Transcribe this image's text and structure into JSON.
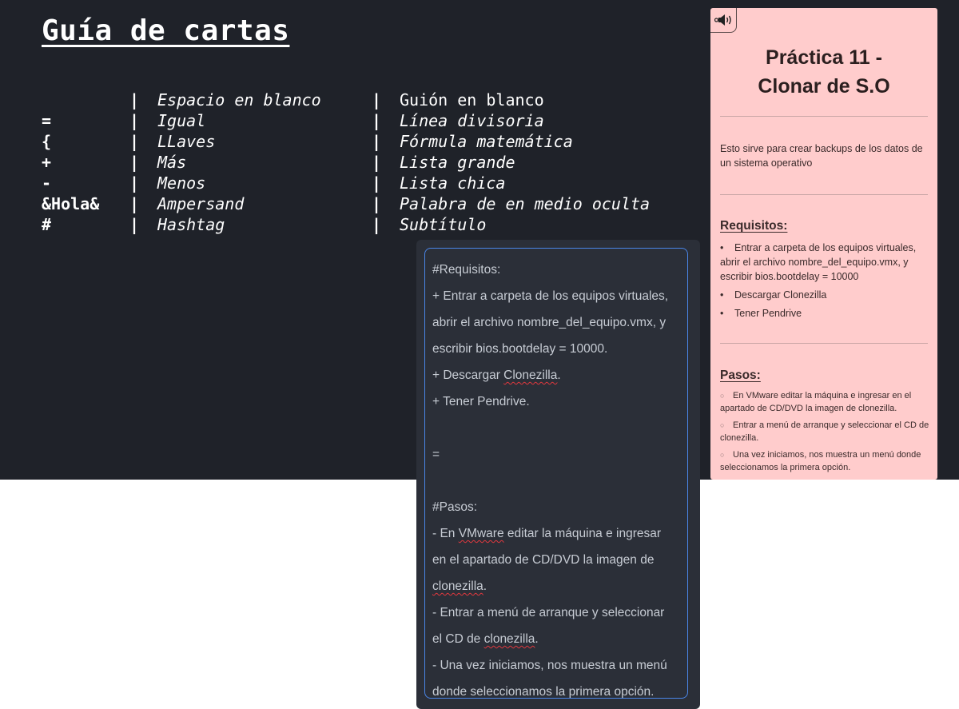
{
  "guide": {
    "title": "Guía de cartas",
    "rows": [
      {
        "symbol": "",
        "name": "Espacio en blanco",
        "desc": "Guión en blanco"
      },
      {
        "symbol": "=",
        "name": "Igual",
        "desc": "Línea divisoria"
      },
      {
        "symbol": "{",
        "name": "LLaves",
        "desc": "Fórmula matemática"
      },
      {
        "symbol": "+",
        "name": "Más",
        "desc": "Lista grande"
      },
      {
        "symbol": "-",
        "name": "Menos",
        "desc": "Lista chica"
      },
      {
        "symbol": "&Hola&",
        "name": "Ampersand",
        "desc": "Palabra de en medio oculta"
      },
      {
        "symbol": "#",
        "name": "Hashtag",
        "desc": "Subtítulo"
      }
    ],
    "separator": "|"
  },
  "editor": {
    "lines": [
      {
        "t": "#Requisitos:"
      },
      {
        "t": "+ Entrar a carpeta de los equipos virtuales,"
      },
      {
        "t": "abrir el archivo nombre_del_equipo.vmx, y"
      },
      {
        "t": "escribir bios.bootdelay = 10000."
      },
      {
        "pre": "+ Descargar ",
        "err": "Clonezilla",
        "post": "."
      },
      {
        "t": "+ Tener Pendrive."
      },
      {
        "t": ""
      },
      {
        "t": "="
      },
      {
        "t": ""
      },
      {
        "t": "#Pasos:"
      },
      {
        "pre": "- En ",
        "err": "VMware",
        "post": " editar la máquina e ingresar"
      },
      {
        "t": "en el apartado de CD/DVD la imagen de"
      },
      {
        "pre": "",
        "err": "clonezilla",
        "post": "."
      },
      {
        "t": "- Entrar a menú de arranque y seleccionar"
      },
      {
        "pre": "el CD de ",
        "err": "clonezilla",
        "post": "."
      },
      {
        "t": "- Una vez iniciamos, nos muestra un menú"
      },
      {
        "t": "donde seleccionamos la primera opción."
      }
    ]
  },
  "card": {
    "title_line1": "Práctica 11 -",
    "title_line2": "Clonar de S.O",
    "description": "Esto sirve para crear backups de los datos de un sistema operativo",
    "requisitos_heading": "Requisitos:",
    "requisitos": [
      "Entrar a carpeta de los equipos virtuales, abrir el archivo nombre_del_equipo.vmx, y escribir bios.bootdelay = 10000",
      "Descargar Clonezilla",
      "Tener Pendrive"
    ],
    "pasos_heading": "Pasos:",
    "pasos": [
      "En VMware editar la máquina e ingresar en el apartado de CD/DVD la imagen de clonezilla.",
      "Entrar a menú de arranque y seleccionar el CD de clonezilla.",
      "Una vez iniciamos, nos muestra un menú donde seleccionamos la primera opción."
    ],
    "sound_icon": "speaker-icon"
  }
}
